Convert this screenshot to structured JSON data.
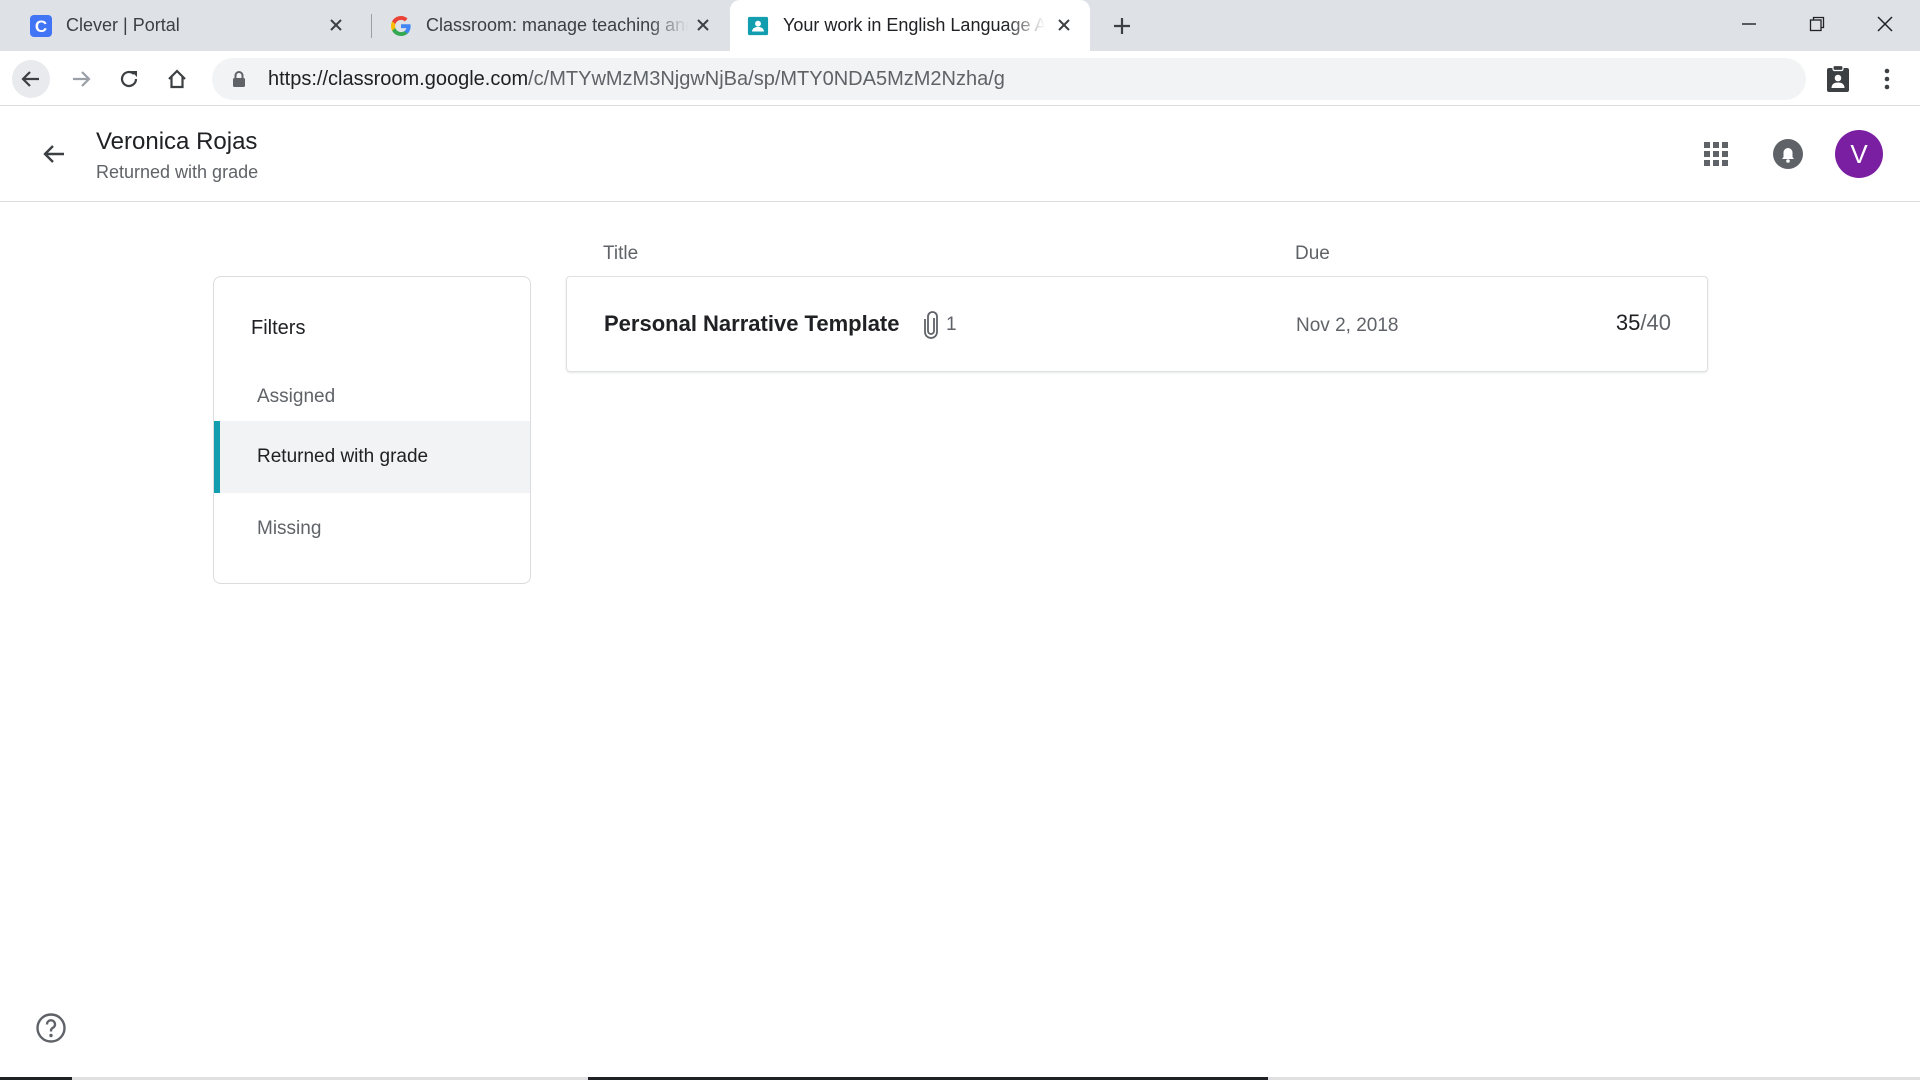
{
  "browser": {
    "tabs": [
      {
        "title": "Clever | Portal",
        "active": false,
        "favicon": "clever-favicon"
      },
      {
        "title": "Classroom: manage teaching and",
        "active": false,
        "favicon": "google-favicon"
      },
      {
        "title": "Your work in English Language A",
        "active": true,
        "favicon": "classroom-favicon"
      }
    ],
    "url_host": "https://classroom.google.com",
    "url_path": "/c/MTYwMzM3NjgwNjBa/sp/MTY0NDA5MzM2Nzha/g"
  },
  "header": {
    "student_name": "Veronica Rojas",
    "status": "Returned with grade",
    "avatar_initial": "V",
    "avatar_color": "#7b1fa2"
  },
  "filters": {
    "title": "Filters",
    "items": [
      {
        "label": "Assigned",
        "active": false
      },
      {
        "label": "Returned with grade",
        "active": true
      },
      {
        "label": "Missing",
        "active": false
      }
    ],
    "accent_color": "#129eaf"
  },
  "columns": {
    "title": "Title",
    "due": "Due"
  },
  "work": [
    {
      "title": "Personal Narrative Template",
      "attachments": "1",
      "due": "Nov 2, 2018",
      "grade": "35",
      "points": "/40"
    }
  ]
}
